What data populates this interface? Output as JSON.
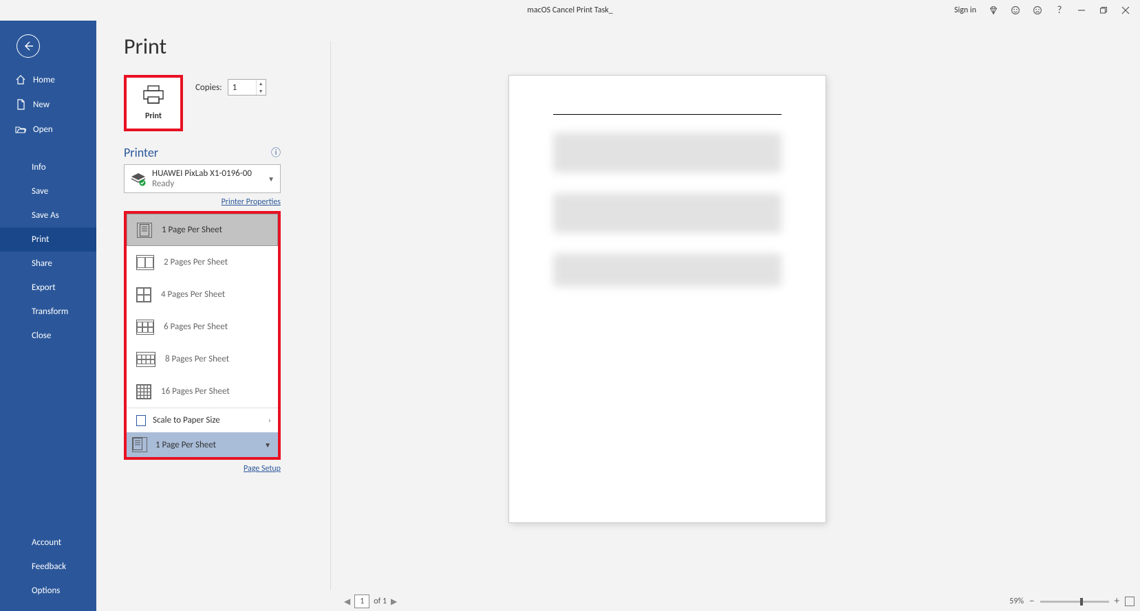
{
  "window": {
    "title": "macOS Cancel Print Task_",
    "sign_in": "Sign in"
  },
  "sidebar": {
    "home": "Home",
    "new": "New",
    "open": "Open",
    "info": "Info",
    "save": "Save",
    "save_as": "Save As",
    "print": "Print",
    "share": "Share",
    "export": "Export",
    "transform": "Transform",
    "close": "Close",
    "account": "Account",
    "feedback": "Feedback",
    "options": "Options"
  },
  "print": {
    "heading": "Print",
    "print_button": "Print",
    "copies_label": "Copies:",
    "copies_value": "1",
    "printer_heading": "Printer",
    "printer_name": "HUAWEI PixLab X1-0196-00",
    "printer_status": "Ready",
    "printer_properties": "Printer Properties",
    "page_setup": "Page Setup"
  },
  "pages_per_sheet": {
    "opt1": "1 Page Per Sheet",
    "opt2": "2 Pages Per Sheet",
    "opt4": "4 Pages Per Sheet",
    "opt6": "6 Pages Per Sheet",
    "opt8": "8 Pages Per Sheet",
    "opt16": "16 Pages Per Sheet",
    "scale": "Scale to Paper Size",
    "current": "1 Page Per Sheet"
  },
  "status": {
    "current_page": "1",
    "page_of": "of 1",
    "zoom": "59%"
  }
}
